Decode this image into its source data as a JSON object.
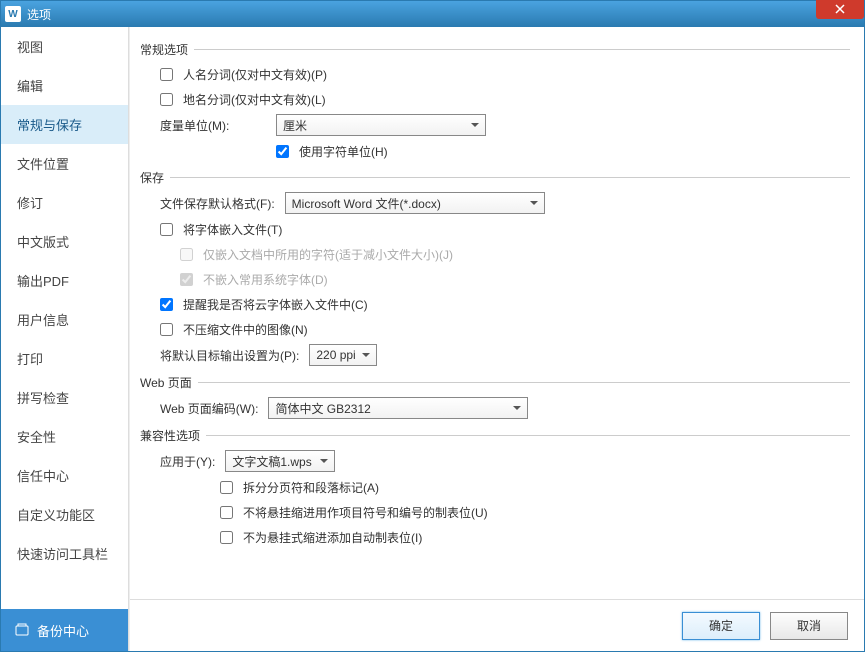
{
  "window": {
    "title": "选项"
  },
  "sidebar": {
    "items": [
      {
        "label": "视图"
      },
      {
        "label": "编辑"
      },
      {
        "label": "常规与保存",
        "selected": true
      },
      {
        "label": "文件位置"
      },
      {
        "label": "修订"
      },
      {
        "label": "中文版式"
      },
      {
        "label": "输出PDF"
      },
      {
        "label": "用户信息"
      },
      {
        "label": "打印"
      },
      {
        "label": "拼写检查"
      },
      {
        "label": "安全性"
      },
      {
        "label": "信任中心"
      },
      {
        "label": "自定义功能区"
      },
      {
        "label": "快速访问工具栏"
      }
    ],
    "backup_label": "备份中心"
  },
  "sections": {
    "general": {
      "title": "常规选项",
      "person_name_seg": "人名分词(仅对中文有效)(P)",
      "place_name_seg": "地名分词(仅对中文有效)(L)",
      "unit_label": "度量单位(M):",
      "unit_value": "厘米",
      "use_char_unit": "使用字符单位(H)"
    },
    "save": {
      "title": "保存",
      "default_format_label": "文件保存默认格式(F):",
      "default_format_value": "Microsoft Word 文件(*.docx)",
      "embed_fonts": "将字体嵌入文件(T)",
      "embed_only_used": "仅嵌入文档中所用的字符(适于减小文件大小)(J)",
      "no_common_sys_fonts": "不嵌入常用系统字体(D)",
      "remind_cloud_font": "提醒我是否将云字体嵌入文件中(C)",
      "no_compress_img": "不压缩文件中的图像(N)",
      "default_output_label": "将默认目标输出设置为(P):",
      "default_output_value": "220 ppi"
    },
    "web": {
      "title": "Web 页面",
      "encoding_label": "Web 页面编码(W):",
      "encoding_value": "简体中文 GB2312"
    },
    "compat": {
      "title": "兼容性选项",
      "apply_to_label": "应用于(Y):",
      "apply_to_value": "文字文稿1.wps",
      "split_page_break": "拆分分页符和段落标记(A)",
      "no_hang_indent": "不将悬挂缩进用作项目符号和编号的制表位(U)",
      "no_auto_tab": "不为悬挂式缩进添加自动制表位(I)"
    }
  },
  "footer": {
    "ok": "确定",
    "cancel": "取消"
  }
}
